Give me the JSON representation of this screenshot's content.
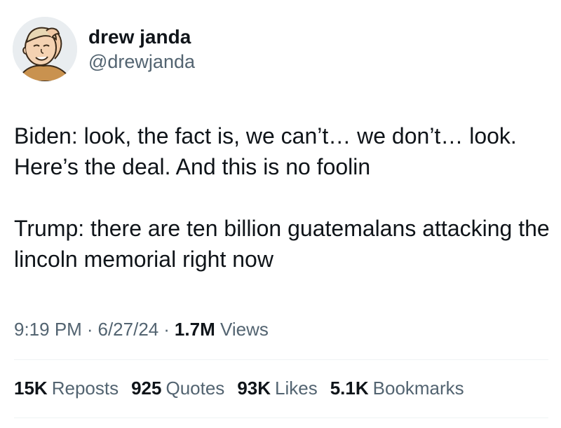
{
  "author": {
    "display_name": "drew janda",
    "handle": "@drewjanda",
    "avatar_icon": "cartoon-avatar"
  },
  "tweet": {
    "paragraphs": [
      "Biden: look, the fact is, we can’t… we don’t… look. Here’s the deal. And this is no foolin",
      "Trump: there are ten billion guatemalans attacking the lincoln memorial right now"
    ]
  },
  "meta": {
    "time": "9:19 PM",
    "date": "6/27/24",
    "views_count": "1.7M",
    "views_label": "Views",
    "separator": "·"
  },
  "stats": {
    "reposts": {
      "count": "15K",
      "label": "Reposts"
    },
    "quotes": {
      "count": "925",
      "label": "Quotes"
    },
    "likes": {
      "count": "93K",
      "label": "Likes"
    },
    "bookmarks": {
      "count": "5.1K",
      "label": "Bookmarks"
    }
  },
  "colors": {
    "text_primary": "#0f1419",
    "text_secondary": "#536471",
    "divider": "#eff3f4"
  }
}
